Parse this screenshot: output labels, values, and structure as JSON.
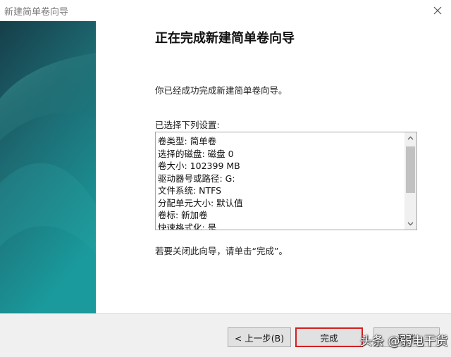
{
  "window": {
    "title": "新建简单卷向导"
  },
  "page": {
    "heading": "正在完成新建简单卷向导",
    "success_message": "你已经成功完成新建简单卷向导。",
    "settings_label": "已选择下列设置:",
    "settings": [
      "卷类型: 简单卷",
      "选择的磁盘: 磁盘 0",
      "卷大小: 102399 MB",
      "驱动器号或路径: G:",
      "文件系统: NTFS",
      "分配单元大小: 默认值",
      "卷标: 新加卷",
      "快速格式化: 是"
    ],
    "close_hint": "若要关闭此向导，请单击“完成”。"
  },
  "buttons": {
    "back_label": "< 上一步(B)",
    "finish_label": "完成",
    "cancel_label": "取消"
  },
  "watermark": "头条 @弱电干货",
  "colors": {
    "side_panel_top": "#1b4b57",
    "side_panel_accent": "#1b8c93",
    "finish_highlight": "#d41f1f",
    "footer_bg": "#f0f0f0"
  }
}
